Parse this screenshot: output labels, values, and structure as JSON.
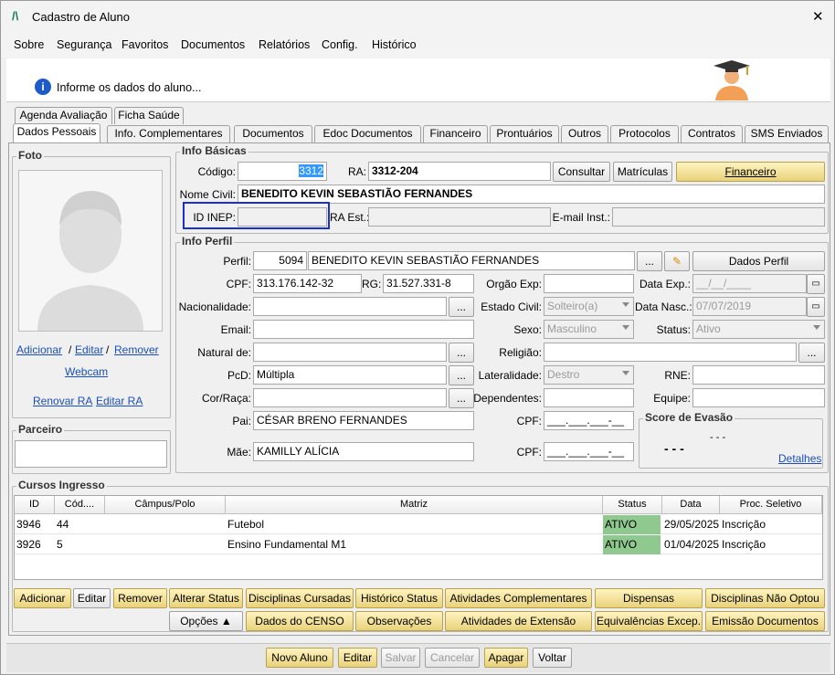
{
  "window": {
    "title": "Cadastro de Aluno",
    "close": "✕"
  },
  "menu": [
    "Sobre",
    "Segurança",
    "Favoritos",
    "Documentos",
    "Relatórios",
    "Config.",
    "Histórico"
  ],
  "header": {
    "info": "Informe os dados do aluno..."
  },
  "tabs_row1": [
    "Agenda Avaliação",
    "Ficha Saúde"
  ],
  "tabs_row2": [
    "Dados Pessoais",
    "Info. Complementares",
    "Documentos",
    "Edoc Documentos",
    "Financeiro",
    "Prontuários",
    "Outros",
    "Protocolos",
    "Contratos",
    "SMS Enviados"
  ],
  "foto": {
    "title": "Foto",
    "adicionar": "Adicionar",
    "editar": "Editar",
    "sep1": "/",
    "sep2": "/",
    "remover": "Remover",
    "webcam": "Webcam",
    "renovar_ra": "Renovar RA",
    "editar_ra": "Editar RA"
  },
  "parceiro": {
    "title": "Parceiro"
  },
  "info_basicas": {
    "title": "Info Básicas",
    "codigo_label": "Código:",
    "codigo": "3312",
    "ra_label": "RA:",
    "ra": "3312-204",
    "consultar": "Consultar",
    "matriculas": "Matrículas",
    "financeiro": "Financeiro",
    "nome_label": "Nome Civil:",
    "nome": "BENEDITO KEVIN SEBASTIÃO FERNANDES",
    "inep_label": "ID INEP:",
    "ra_est_label": "RA Est.:",
    "email_inst_label": "E-mail Inst.:"
  },
  "info_perfil": {
    "title": "Info Perfil",
    "perfil_label": "Perfil:",
    "perfil_id": "5094",
    "perfil_nome": "BENEDITO KEVIN SEBASTIÃO FERNANDES",
    "dots": "...",
    "dados_perfil": "Dados Perfil",
    "cpf_label": "CPF:",
    "cpf": "313.176.142-32",
    "rg_label": "RG:",
    "rg": "31.527.331-8",
    "orgao_label": "Orgão Exp:",
    "data_exp_label": "Data Exp.:",
    "data_exp": "__/__/____",
    "nacionalidade_label": "Nacionalidade:",
    "estado_civil_label": "Estado Civil:",
    "estado_civil": "Solteiro(a)",
    "data_nasc_label": "Data Nasc.:",
    "data_nasc": "07/07/2019",
    "email_label": "Email:",
    "sexo_label": "Sexo:",
    "sexo": "Masculino",
    "status_label": "Status:",
    "status": "Ativo",
    "natural_label": "Natural de:",
    "religiao_label": "Religião:",
    "pcd_label": "PcD:",
    "pcd": "Múltipla",
    "lateralidade_label": "Lateralidade:",
    "lateralidade": "Destro",
    "rne_label": "RNE:",
    "cor_label": "Cor/Raça:",
    "dependentes_label": "Dependentes:",
    "equipe_label": "Equipe:",
    "pai_label": "Pai:",
    "pai": "CÉSAR BRENO FERNANDES",
    "cpf_pai_label": "CPF:",
    "cpf_mask": "___.___.___-__",
    "mae_label": "Mãe:",
    "mae": "KAMILLY ALÍCIA",
    "cpf_mae_label": "CPF:"
  },
  "evasao": {
    "title": "Score de Evasão",
    "small": "- - -",
    "big": "- - -",
    "detalhes": "Detalhes"
  },
  "cursos": {
    "title": "Cursos Ingresso",
    "columns": [
      "ID",
      "Cód....",
      "Câmpus/Polo",
      "Matriz",
      "Status",
      "Data",
      "Proc. Seletivo"
    ],
    "rows": [
      [
        "3946",
        "44",
        "",
        "Futebol",
        "ATIVO",
        "29/05/2025",
        "Inscrição"
      ],
      [
        "3926",
        "5",
        "",
        "Ensino Fundamental M1",
        "ATIVO",
        "01/04/2025",
        "Inscrição"
      ]
    ]
  },
  "actions_row1": [
    "Adicionar",
    "Editar",
    "Remover",
    "Alterar Status",
    "Disciplinas Cursadas",
    "Histórico Status",
    "Atividades Complementares",
    "Dispensas",
    "Disciplinas Não Optou"
  ],
  "actions_row2": [
    "Opções ▲",
    "Dados do CENSO",
    "Observações",
    "Atividades de Extensão",
    "Equivalências Excep.",
    "Emissão Documentos"
  ],
  "footer": [
    "Novo Aluno",
    "Editar",
    "Salvar",
    "Cancelar",
    "Apagar",
    "Voltar"
  ],
  "colors": {
    "gold": "#e8d27a",
    "status_green": "#8fc98f",
    "highlight_border": "#1a2fd0",
    "selection": "#3399ff"
  }
}
